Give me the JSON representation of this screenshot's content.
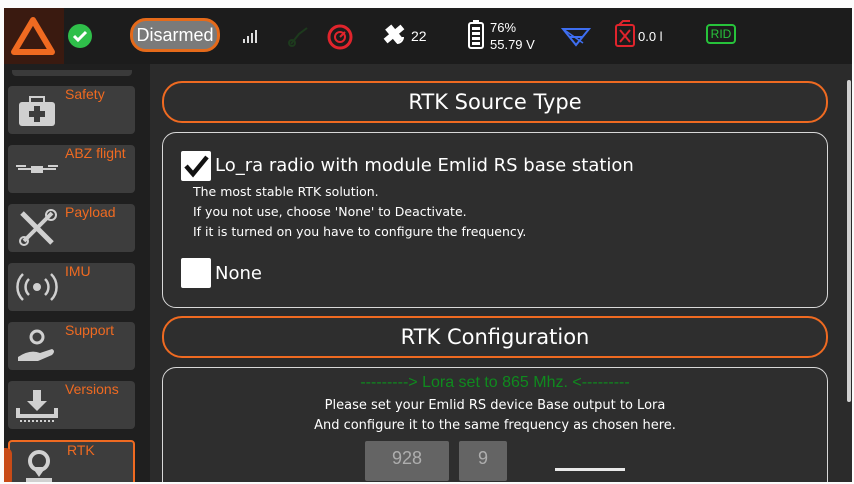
{
  "topbar": {
    "arm_state": "Disarmed",
    "satellites": "22",
    "battery_percent": "76%",
    "battery_voltage": "55.79 V",
    "tank_level": "0.0 l",
    "rid_label": "RID",
    "icons": [
      "app-logo-icon",
      "status-ok-icon",
      "signal-bars-icon",
      "rc-link-icon",
      "compass-timer-icon",
      "gps-satellite-icon",
      "battery-icon",
      "mission-icon",
      "fuel-can-icon"
    ]
  },
  "sidebar": {
    "items": [
      {
        "label": "Safety",
        "icon": "first-aid-kit-icon"
      },
      {
        "label": "ABZ flight",
        "icon": "drone-icon"
      },
      {
        "label": "Payload",
        "icon": "tools-icon"
      },
      {
        "label": "IMU",
        "icon": "broadcast-icon"
      },
      {
        "label": "Support",
        "icon": "support-hand-icon"
      },
      {
        "label": "Versions",
        "icon": "download-tray-icon"
      },
      {
        "label": "RTK",
        "icon": "location-icon"
      }
    ],
    "active": "RTK"
  },
  "rtk_source": {
    "header": "RTK Source Type",
    "option_lora": {
      "label": "Lo_ra radio with module Emlid RS base station",
      "checked": true,
      "desc1": "The most stable RTK solution.",
      "desc2": "If you not use, choose 'None' to Deactivate.",
      "desc3": "If it is turned on you have to configure the frequency."
    },
    "option_none": {
      "label": "None",
      "checked": false
    }
  },
  "rtk_config": {
    "header": "RTK Configuration",
    "status": "---------> Lora set to 865 Mhz. <---------",
    "info1": "Please set your Emlid RS device Base output to Lora",
    "info2": "And configure it to the same frequency as chosen here.",
    "freq_main": "928",
    "freq_decimal": "9"
  },
  "colors": {
    "accent": "#ef6a21",
    "ok": "#2fbf4a",
    "status_green": "#0f8a1e",
    "rid_green": "#27c33b",
    "alert_red": "#e0242c",
    "link_blue": "#3e6ef0"
  }
}
